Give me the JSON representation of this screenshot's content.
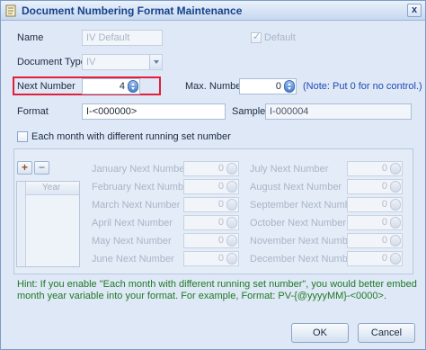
{
  "window": {
    "title": "Document Numbering Format Maintenance",
    "close_label": "x"
  },
  "form": {
    "name_label": "Name",
    "name_value": "IV Default",
    "default_label": "Default",
    "default_checked": true,
    "doc_type_label": "Document Type",
    "doc_type_value": "IV",
    "next_number_label": "Next Number",
    "next_number_value": "4",
    "max_number_label": "Max. Number",
    "max_number_value": "0",
    "max_note": "(Note: Put 0 for no control.)",
    "format_label": "Format",
    "format_value": "I-<000000>",
    "sample_label": "Sample",
    "sample_value": "I-000004",
    "monthly_label": "Each month with different running set number",
    "monthly_checked": false
  },
  "panel": {
    "add_label": "+",
    "remove_label": "−",
    "grid_column": "Year",
    "months": [
      {
        "label": "January Next Number",
        "value": "0"
      },
      {
        "label": "February Next Number",
        "value": "0"
      },
      {
        "label": "March Next Number",
        "value": "0"
      },
      {
        "label": "April Next Number",
        "value": "0"
      },
      {
        "label": "May Next Number",
        "value": "0"
      },
      {
        "label": "June Next Number",
        "value": "0"
      },
      {
        "label": "July Next Number",
        "value": "0"
      },
      {
        "label": "August Next Number",
        "value": "0"
      },
      {
        "label": "September Next Number",
        "value": "0"
      },
      {
        "label": "October Next Number",
        "value": "0"
      },
      {
        "label": "November Next Number",
        "value": "0"
      },
      {
        "label": "December Next Number",
        "value": "0"
      }
    ]
  },
  "hint": "Hint: If you enable \"Each month with different running set number\", you would better embed month year variable into your format. For example, Format: PV-{@yyyyMM}-<0000>.",
  "buttons": {
    "ok": "OK",
    "cancel": "Cancel"
  },
  "colors": {
    "accent": "#15428b",
    "highlight": "#e0203c",
    "hint": "#1d7a24",
    "note": "#1f49b6"
  }
}
